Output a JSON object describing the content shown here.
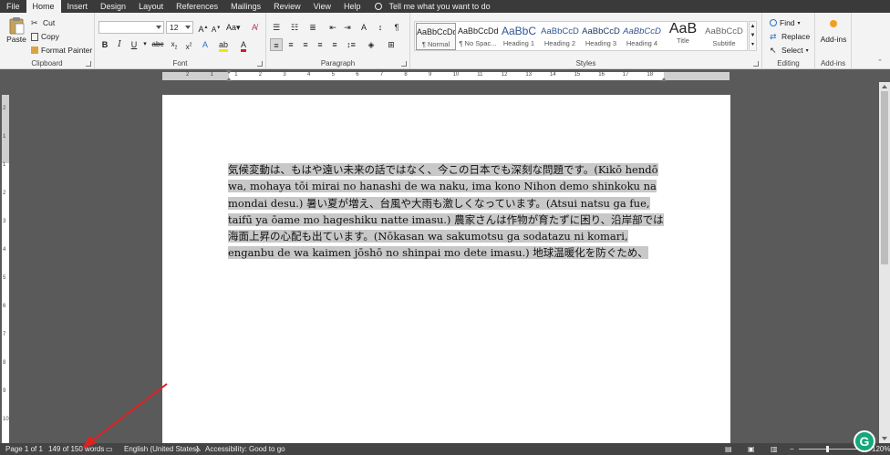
{
  "tabs": [
    "File",
    "Home",
    "Insert",
    "Design",
    "Layout",
    "References",
    "Mailings",
    "Review",
    "View",
    "Help"
  ],
  "active_tab": "Home",
  "tell_me": "Tell me what you want to do",
  "clipboard": {
    "paste": "Paste",
    "cut": "Cut",
    "copy": "Copy",
    "format_painter": "Format Painter",
    "label": "Clipboard"
  },
  "font": {
    "name_value": "",
    "size_value": "12",
    "label": "Font"
  },
  "paragraph": {
    "label": "Paragraph"
  },
  "styles": {
    "label": "Styles",
    "items": [
      {
        "sample": "AaBbCcDd",
        "name": "¶ Normal"
      },
      {
        "sample": "AaBbCcDd",
        "name": "¶ No Spac..."
      },
      {
        "sample": "AaBbC",
        "name": "Heading 1"
      },
      {
        "sample": "AaBbCcD",
        "name": "Heading 2"
      },
      {
        "sample": "AaBbCcD",
        "name": "Heading 3"
      },
      {
        "sample": "AaBbCcD",
        "name": "Heading 4"
      },
      {
        "sample": "AaB",
        "name": "Title"
      },
      {
        "sample": "AaBbCcD",
        "name": "Subtitle"
      }
    ]
  },
  "editing": {
    "find": "Find",
    "replace": "Replace",
    "select": "Select",
    "label": "Editing"
  },
  "addins": {
    "button": "Add-ins",
    "label": "Add-ins"
  },
  "ruler_h_ticks": [
    "2",
    "1",
    "1",
    "2",
    "3",
    "4",
    "5",
    "6",
    "7",
    "8",
    "9",
    "10",
    "11",
    "12",
    "13",
    "14",
    "15",
    "16",
    "17",
    "18"
  ],
  "ruler_v_ticks": [
    "2",
    "1",
    "1",
    "2",
    "3",
    "4",
    "5",
    "6",
    "7",
    "8",
    "9",
    "10"
  ],
  "document": {
    "paragraph": "気候変動は、もはや遠い未来の話ではなく、今この日本でも深刻な問題です。(Kikō hendō wa, mohaya tōi mirai no hanashi de wa naku, ima kono Nihon demo shinkoku na mondai desu.) 暑い夏が増え、台風や大雨も激しくなっています。(Atsui natsu ga fue, taifū ya ōame mo hageshiku natte imasu.) 農家さんは作物が育たずに困り、沿岸部では海面上昇の心配も出ています。(Nōkasan wa sakumotsu ga sodatazu ni komari, enganbu de wa kaimen jōshō no shinpai mo dete imasu.) 地球温暖化を防ぐため、"
  },
  "status": {
    "page": "Page 1 of 1",
    "words": "149 of 150 words",
    "language": "English (United States)",
    "accessibility": "Accessibility: Good to go",
    "zoom": "120%"
  },
  "colors": {
    "tabbar": "#3a3a3a",
    "ribbon": "#f3f3f3",
    "canvas": "#5a5a5a",
    "highlight": "#c8c8c8",
    "annotation_arrow": "#e02020",
    "grammarly": "#15a87a"
  }
}
